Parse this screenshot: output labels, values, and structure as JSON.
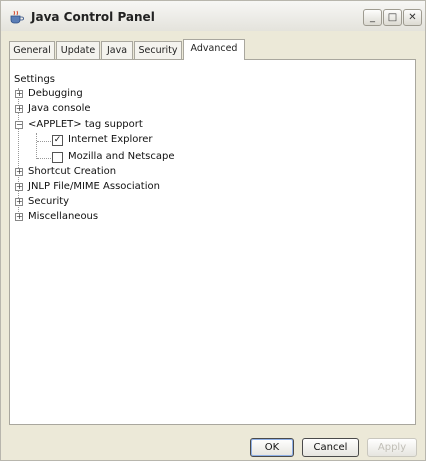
{
  "window": {
    "title": "Java Control Panel"
  },
  "tabs": [
    {
      "label": "General"
    },
    {
      "label": "Update"
    },
    {
      "label": "Java"
    },
    {
      "label": "Security"
    },
    {
      "label": "Advanced",
      "active": true
    }
  ],
  "settings": {
    "root_label": "Settings",
    "items": [
      {
        "label": "Debugging",
        "expanded": false
      },
      {
        "label": "Java console",
        "expanded": false
      },
      {
        "label": "<APPLET> tag support",
        "expanded": true,
        "children": [
          {
            "label": "Internet Explorer",
            "checked": true
          },
          {
            "label": "Mozilla and Netscape",
            "checked": false
          }
        ]
      },
      {
        "label": "Shortcut Creation",
        "expanded": false
      },
      {
        "label": "JNLP File/MIME Association",
        "expanded": false
      },
      {
        "label": "Security",
        "expanded": false
      },
      {
        "label": "Miscellaneous",
        "expanded": false
      }
    ]
  },
  "buttons": {
    "ok": "OK",
    "cancel": "Cancel",
    "apply": "Apply"
  }
}
